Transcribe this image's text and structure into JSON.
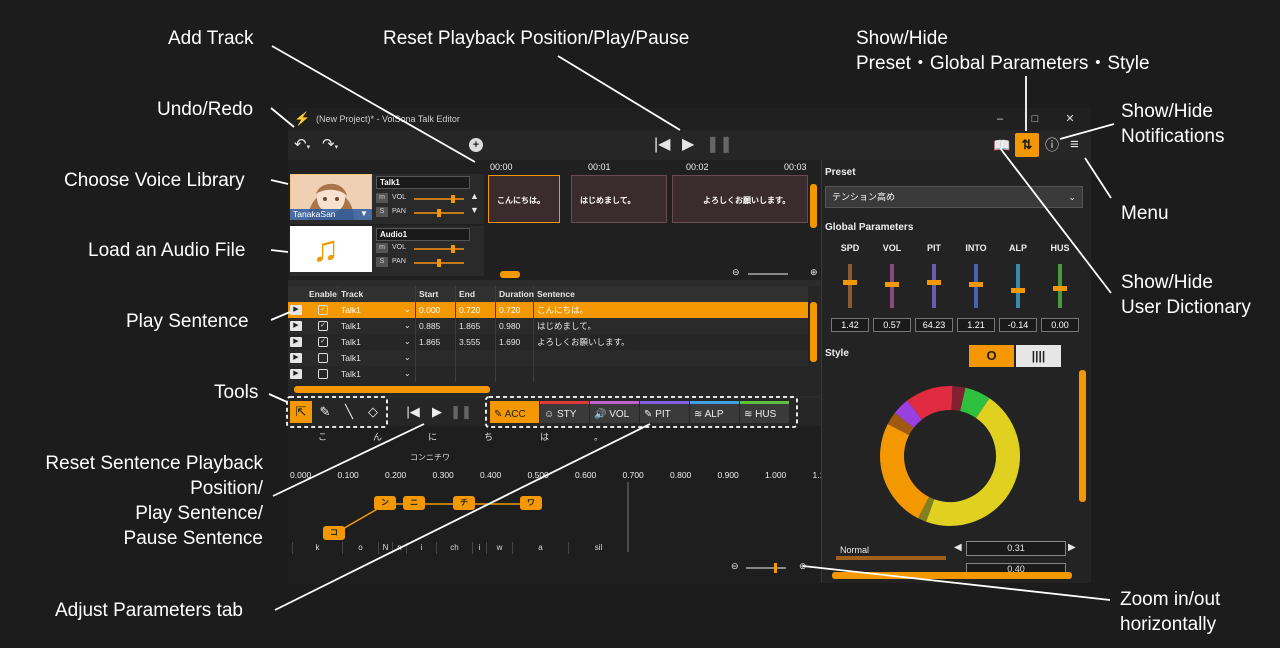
{
  "callouts": {
    "add_track": "Add Track",
    "reset_play_pause": "Reset Playback Position/Play/Pause",
    "show_hide_preset_1": "Show/Hide",
    "show_hide_preset_2": "Preset・Global Parameters・Style",
    "undo_redo": "Undo/Redo",
    "show_hide_notifications_1": "Show/Hide",
    "show_hide_notifications_2": "Notifications",
    "choose_voice_library": "Choose Voice Library",
    "menu": "Menu",
    "load_audio_file": "Load an Audio File",
    "show_hide_dictionary_1": "Show/Hide",
    "show_hide_dictionary_2": "User Dictionary",
    "play_sentence": "Play Sentence",
    "tools": "Tools",
    "reset_sentence_1": "Reset Sentence Playback",
    "reset_sentence_2": "Position/",
    "reset_sentence_3": "Play Sentence/",
    "reset_sentence_4": "Pause Sentence",
    "adjust_parameters_tab": "Adjust Parameters tab",
    "zoom_1": "Zoom in/out",
    "zoom_2": "horizontally"
  },
  "window": {
    "title": "(New Project)* - VoiSona Talk Editor",
    "minimize": "–",
    "maximize": "□",
    "close": "✕"
  },
  "toolbar": {
    "undo_icon": "undo-icon",
    "redo_icon": "redo-icon",
    "add_track": "+"
  },
  "tracks": [
    {
      "name": "Talk1",
      "voice": "TanakaSan",
      "m": "m",
      "s": "S",
      "vol": "VOL",
      "pan": "PAN",
      "vol_level": 0.8,
      "pan_level": 0.5
    },
    {
      "name": "Audio1",
      "m": "m",
      "s": "S",
      "vol": "VOL",
      "pan": "PAN",
      "vol_level": 0.8,
      "pan_level": 0.5
    }
  ],
  "ruler": [
    "00:00",
    "00:01",
    "00:02",
    "00:03"
  ],
  "clips": [
    "こんにちは。",
    "はじめまして。",
    "よろしくお願いします。"
  ],
  "table": {
    "headers": [
      "Enable",
      "Track",
      "Start",
      "End",
      "Duration",
      "Sentence"
    ],
    "rows": [
      {
        "enabled": true,
        "track": "Talk1",
        "start": "0.000",
        "end": "0.720",
        "duration": "0.720",
        "sentence": "こんにちは。",
        "selected": true
      },
      {
        "enabled": true,
        "track": "Talk1",
        "start": "0.885",
        "end": "1.865",
        "duration": "0.980",
        "sentence": "はじめまして。",
        "selected": false
      },
      {
        "enabled": true,
        "track": "Talk1",
        "start": "1.865",
        "end": "3.555",
        "duration": "1.690",
        "sentence": "よろしくお願いします。",
        "selected": false
      },
      {
        "enabled": false,
        "track": "Talk1",
        "start": "",
        "end": "",
        "duration": "",
        "sentence": "",
        "selected": false
      },
      {
        "enabled": false,
        "track": "Talk1",
        "start": "",
        "end": "",
        "duration": "",
        "sentence": "",
        "selected": false
      }
    ]
  },
  "tabs": [
    {
      "label": "ACC",
      "color": "#f39800",
      "active": true
    },
    {
      "label": "STY",
      "color": "#e03a3a",
      "active": false
    },
    {
      "label": "VOL",
      "color": "#c060d0",
      "active": false
    },
    {
      "label": "PIT",
      "color": "#8060e0",
      "active": false
    },
    {
      "label": "ALP",
      "color": "#40a0e0",
      "active": false
    },
    {
      "label": "HUS",
      "color": "#60c040",
      "active": false
    }
  ],
  "editor": {
    "kana": [
      "こ",
      "ん",
      "に",
      "ち",
      "は",
      "。"
    ],
    "reading": "コンニチワ",
    "ticks": [
      "0.000",
      "0.100",
      "0.200",
      "0.300",
      "0.400",
      "0.500",
      "0.600",
      "0.700",
      "0.800",
      "0.900",
      "1.000",
      "1.1"
    ],
    "accent_boxes": [
      "コ",
      "ン",
      "ニ",
      "チ",
      "ワ"
    ],
    "phonemes": [
      "k",
      "o",
      "N",
      "n",
      "i",
      "ch",
      "i",
      "w",
      "a",
      "sil"
    ]
  },
  "right_panel": {
    "preset_label": "Preset",
    "preset_value": "テンション高め",
    "global_label": "Global Parameters",
    "params": [
      {
        "name": "SPD",
        "value": "1.42",
        "color": "#8a5a30",
        "level": 0.6
      },
      {
        "name": "VOL",
        "value": "0.57",
        "color": "#8a4a80",
        "level": 0.55
      },
      {
        "name": "PIT",
        "value": "64.23",
        "color": "#6a5ab0",
        "level": 0.6
      },
      {
        "name": "INTO",
        "value": "1.21",
        "color": "#4a60b0",
        "level": 0.55
      },
      {
        "name": "ALP",
        "value": "-0.14",
        "color": "#3a8ab0",
        "level": 0.4
      },
      {
        "name": "HUS",
        "value": "0.00",
        "color": "#4a9a40",
        "level": 0.45
      }
    ],
    "style_label": "Style",
    "style_tabs": [
      "O",
      "||||"
    ],
    "styles": [
      {
        "name": "Normal",
        "value": "0.31"
      },
      {
        "name": "",
        "value": "0.40"
      }
    ],
    "donut": [
      {
        "color": "#e0d020",
        "fraction": 0.46
      },
      {
        "color": "#808020",
        "fraction": 0.02
      },
      {
        "color": "#f39800",
        "fraction": 0.25
      },
      {
        "color": "#a05a10",
        "fraction": 0.03
      },
      {
        "color": "#9a40e0",
        "fraction": 0.04
      },
      {
        "color": "#e02a40",
        "fraction": 0.11
      },
      {
        "color": "#802030",
        "fraction": 0.03
      },
      {
        "color": "#30c040",
        "fraction": 0.06
      }
    ]
  },
  "colors": {
    "accent": "#f39800",
    "bg": "#1c1c1c"
  }
}
